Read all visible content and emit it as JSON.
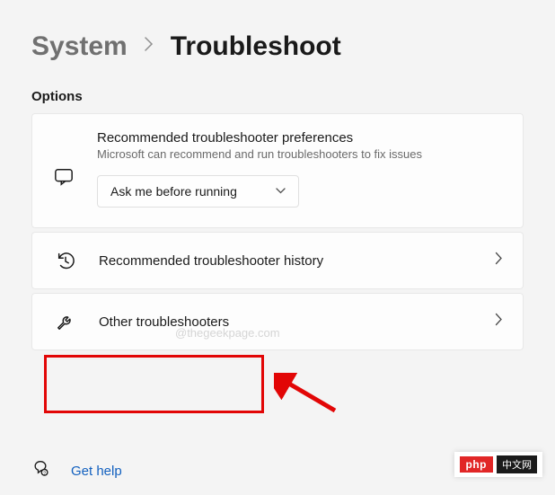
{
  "breadcrumb": {
    "parent": "System",
    "current": "Troubleshoot"
  },
  "section_label": "Options",
  "preferences_card": {
    "title": "Recommended troubleshooter preferences",
    "subtitle": "Microsoft can recommend and run troubleshooters to fix issues",
    "dropdown_value": "Ask me before running"
  },
  "rows": {
    "history": {
      "label": "Recommended troubleshooter history"
    },
    "other": {
      "label": "Other troubleshooters"
    }
  },
  "help": {
    "label": "Get help"
  },
  "watermark": "@thegeekpage.com",
  "badge": {
    "php": "php",
    "tail": "中文网"
  }
}
